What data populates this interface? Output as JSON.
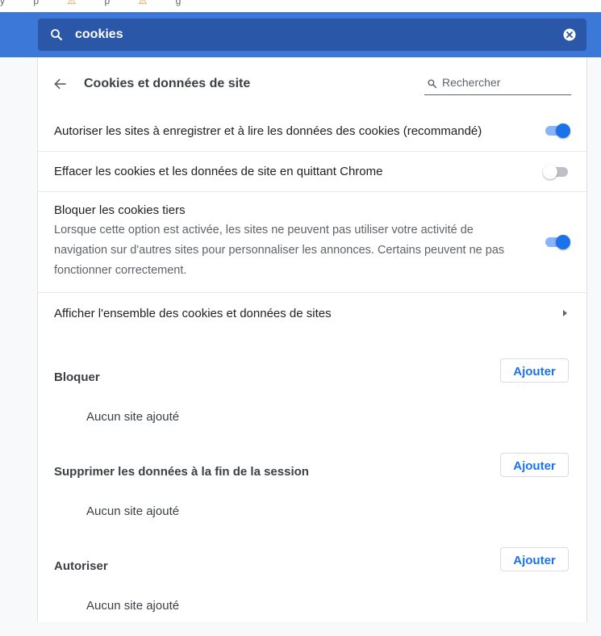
{
  "top_strip": {
    "fragments": [
      "y",
      "p",
      "⚠",
      "p",
      "⚠",
      "g"
    ]
  },
  "search": {
    "query": "cookies",
    "icon": "search-icon",
    "clear_icon": "close-circle-icon"
  },
  "page": {
    "title": "Cookies et données de site",
    "back_icon": "arrow-back-icon",
    "search_placeholder": "Rechercher"
  },
  "settings": [
    {
      "label": "Autoriser les sites à enregistrer et à lire les données des cookies (recommandé)",
      "enabled": true
    },
    {
      "label": "Effacer les cookies et les données de site en quittant Chrome",
      "enabled": false
    },
    {
      "label": "Bloquer les cookies tiers",
      "description": "Lorsque cette option est activée, les sites ne peuvent pas utiliser votre activité de navigation sur d'autres sites pour personnaliser les annonces. Certains peuvent ne pas fonctionner correctement.",
      "enabled": true
    }
  ],
  "all_cookies_link": {
    "label": "Afficher l'ensemble des cookies et données de sites",
    "icon": "chevron-right-icon"
  },
  "sections": [
    {
      "title": "Bloquer",
      "button": "Ajouter",
      "empty": "Aucun site ajouté"
    },
    {
      "title": "Supprimer les données à la fin de la session",
      "button": "Ajouter",
      "empty": "Aucun site ajouté"
    },
    {
      "title": "Autoriser",
      "button": "Ajouter",
      "empty": "Aucun site ajouté"
    }
  ],
  "colors": {
    "header_blue": "#3c78d8",
    "search_bg": "#2a57a8",
    "accent": "#1a73e8"
  }
}
